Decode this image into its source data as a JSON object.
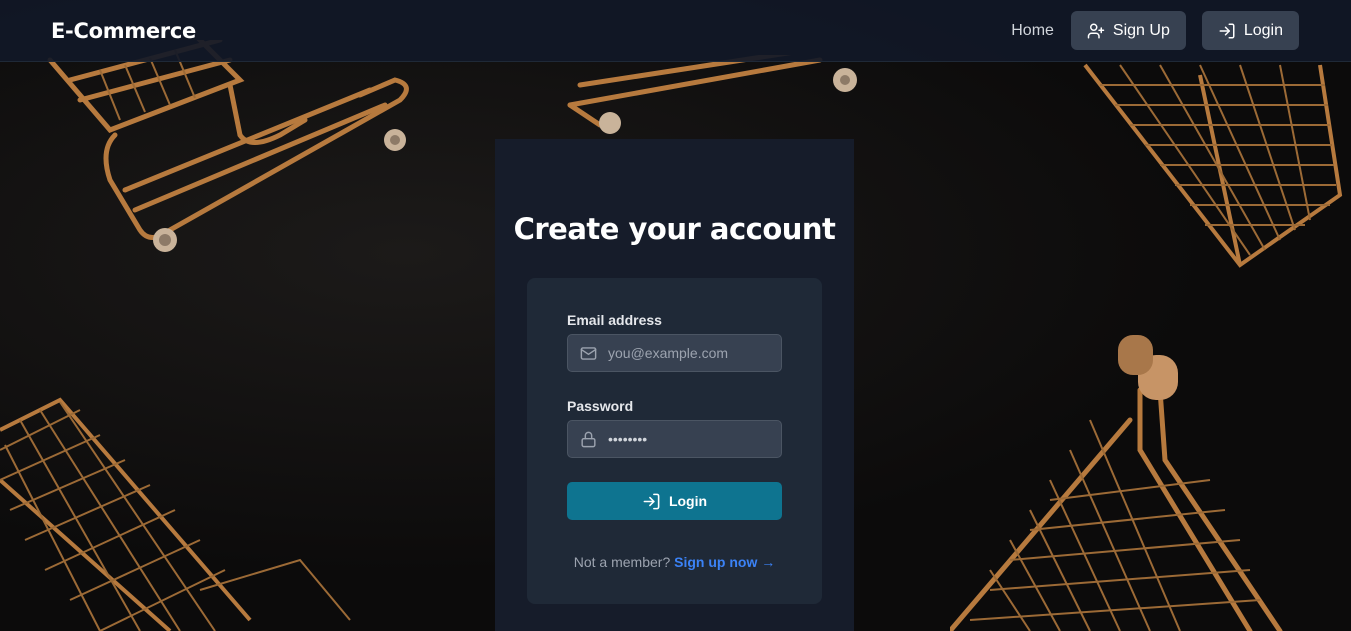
{
  "navbar": {
    "brand": "E-Commerce",
    "home_label": "Home",
    "signup_label": "Sign Up",
    "login_label": "Login"
  },
  "form": {
    "heading": "Create your account",
    "email_label": "Email address",
    "email_placeholder": "you@example.com",
    "password_label": "Password",
    "password_value": "••••••••",
    "login_button": "Login",
    "not_member_text": "Not a member?",
    "signup_link": "Sign up now"
  },
  "icons": {
    "signup": "user-plus-icon",
    "login": "login-icon",
    "email": "mail-icon",
    "password": "lock-icon",
    "arrow": "arrow-right-icon"
  },
  "colors": {
    "accent": "#0e7490",
    "link": "#3b82f6",
    "card": "#161c2a",
    "form": "#1f2937"
  }
}
